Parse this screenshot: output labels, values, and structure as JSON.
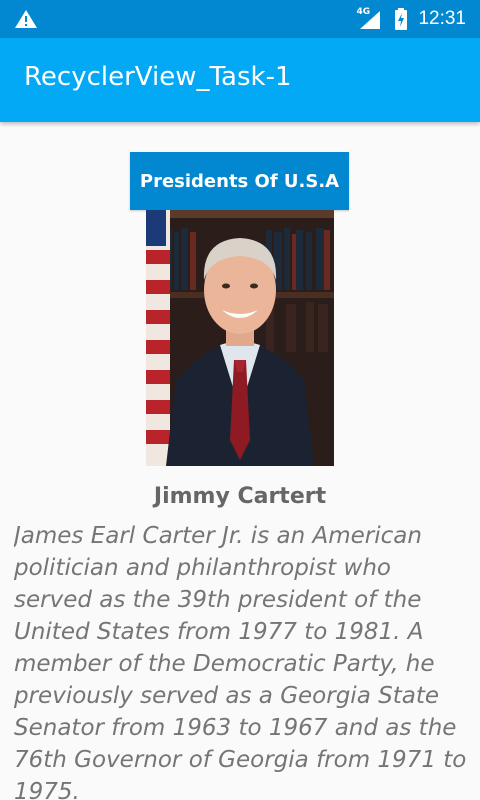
{
  "status_bar": {
    "network": "4G",
    "time": "12:31"
  },
  "app_bar": {
    "title": "RecyclerView_Task-1"
  },
  "content": {
    "header_button": "Presidents Of U.S.A",
    "item": {
      "name": "Jimmy Cartert",
      "description": "James Earl Carter Jr. is an American politician and philanthropist who served as the 39th president of the United States from 1977 to 1981. A member of the Democratic Party, he previously served as a Georgia State Senator from 1963 to 1967 and as the 76th Governor of Georgia from 1971 to 1975."
    }
  },
  "colors": {
    "status_bar": "#0288d1",
    "app_bar": "#03a9f4",
    "button": "#0288d1"
  }
}
